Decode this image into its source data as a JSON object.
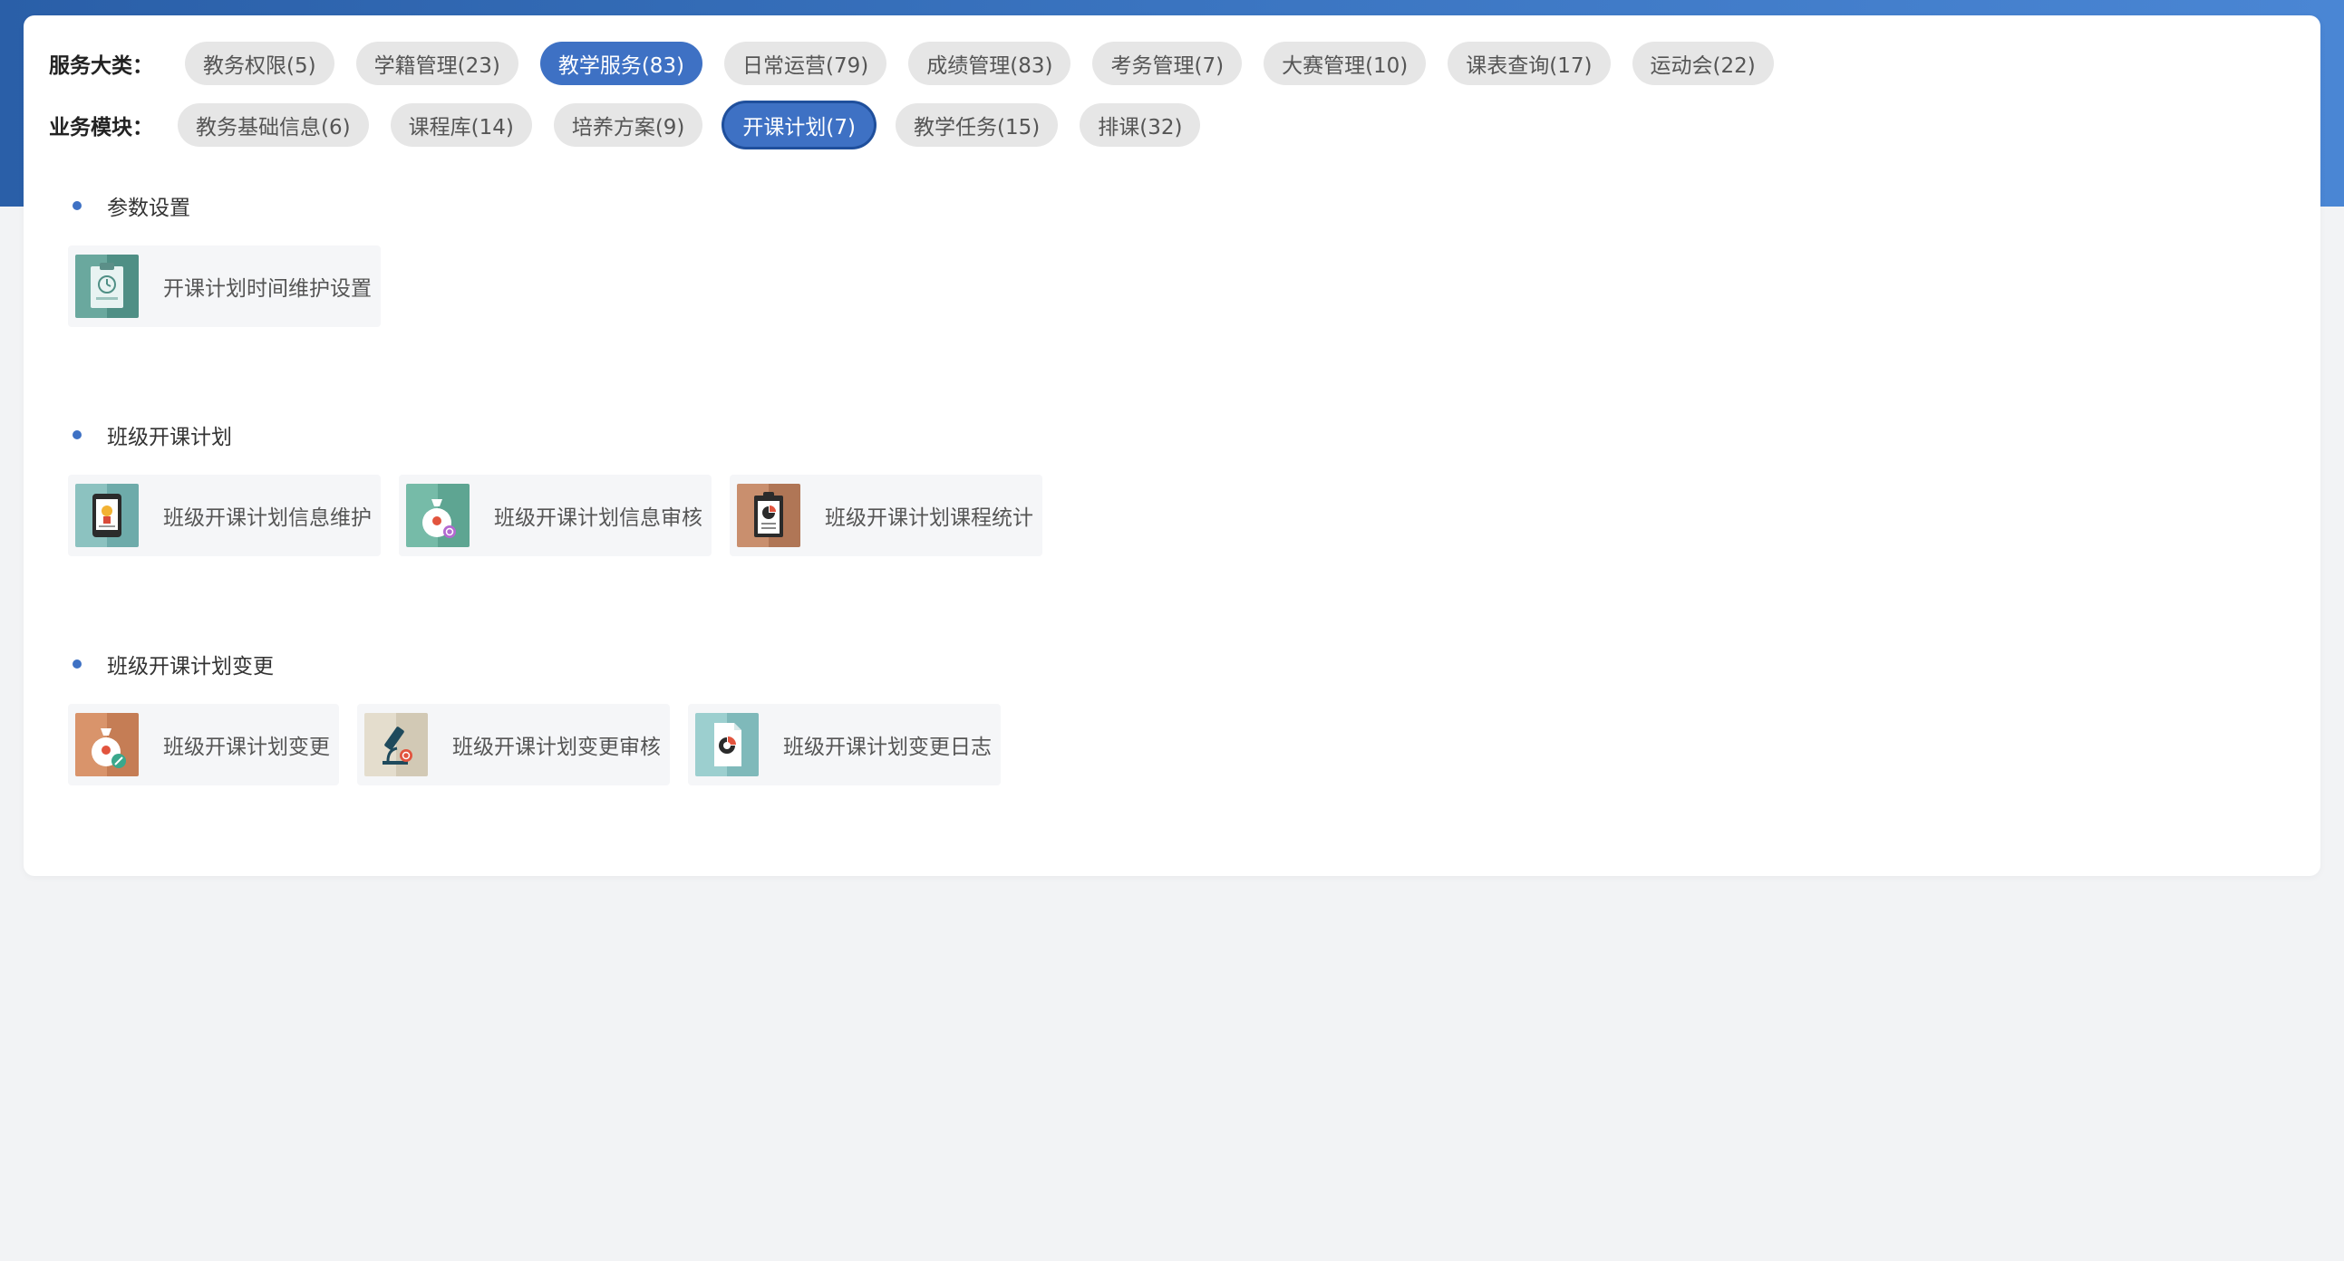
{
  "filters": {
    "service_label": "服务大类：",
    "service_chips": [
      "教务权限(5)",
      "学籍管理(23)",
      "教学服务(83)",
      "日常运营(79)",
      "成绩管理(83)",
      "考务管理(7)",
      "大赛管理(10)",
      "课表查询(17)",
      "运动会(22)"
    ],
    "module_label": "业务模块：",
    "module_chips": [
      "教务基础信息(6)",
      "课程库(14)",
      "培养方案(9)",
      "开课计划(7)",
      "教学任务(15)",
      "排课(32)"
    ]
  },
  "sections": [
    {
      "title": "参数设置",
      "cards": [
        {
          "label": "开课计划时间维护设置",
          "icon": "clipboard-clock-icon"
        }
      ]
    },
    {
      "title": "班级开课计划",
      "cards": [
        {
          "label": "班级开课计划信息维护",
          "icon": "tablet-award-icon"
        },
        {
          "label": "班级开课计划信息审核",
          "icon": "money-bag-search-icon"
        },
        {
          "label": "班级开课计划课程统计",
          "icon": "clipboard-chart-icon"
        }
      ]
    },
    {
      "title": "班级开课计划变更",
      "cards": [
        {
          "label": "班级开课计划变更",
          "icon": "money-bag-edit-icon"
        },
        {
          "label": "班级开课计划变更审核",
          "icon": "microscope-search-icon"
        },
        {
          "label": "班级开课计划变更日志",
          "icon": "document-chart-icon"
        }
      ]
    }
  ]
}
